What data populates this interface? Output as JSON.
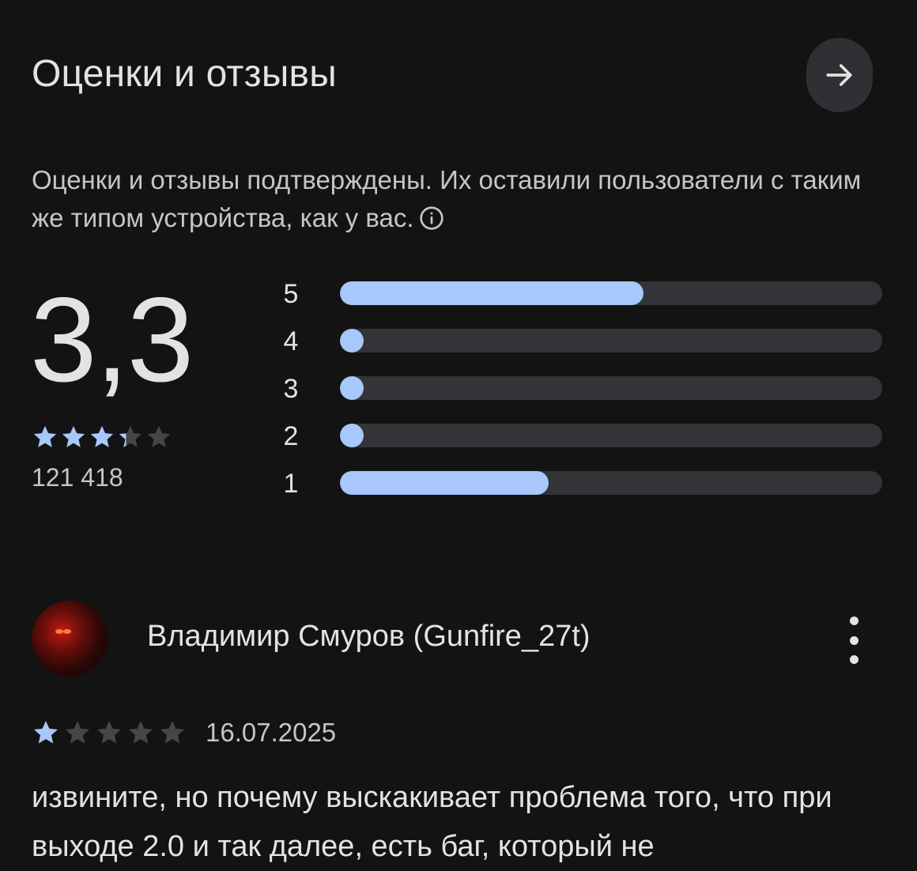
{
  "header": {
    "title": "Оценки и отзывы",
    "arrow_icon": "arrow-right-icon"
  },
  "summary": {
    "verified_text": "Оценки и отзывы подтверждены. Их оставили пользователи с таким же типом устройства, как у вас.",
    "rating": "3,3",
    "rating_value": 3.3,
    "ratings_count": "121 418"
  },
  "distribution": [
    {
      "label": "5",
      "fraction": 0.56
    },
    {
      "label": "4",
      "fraction": 0.04
    },
    {
      "label": "3",
      "fraction": 0.04
    },
    {
      "label": "2",
      "fraction": 0.04
    },
    {
      "label": "1",
      "fraction": 0.385
    }
  ],
  "review": {
    "author": "Владимир Смуров (Gunfire_27t)",
    "stars": 1,
    "date": "16.07.2025",
    "text": "извините, но почему выскакивает проблема того, что при выходе 2.0 и так далее, есть баг, который не"
  },
  "colors": {
    "accent": "#a8c7fa",
    "track": "#333437",
    "star_empty": "#444746",
    "background": "#131314"
  }
}
